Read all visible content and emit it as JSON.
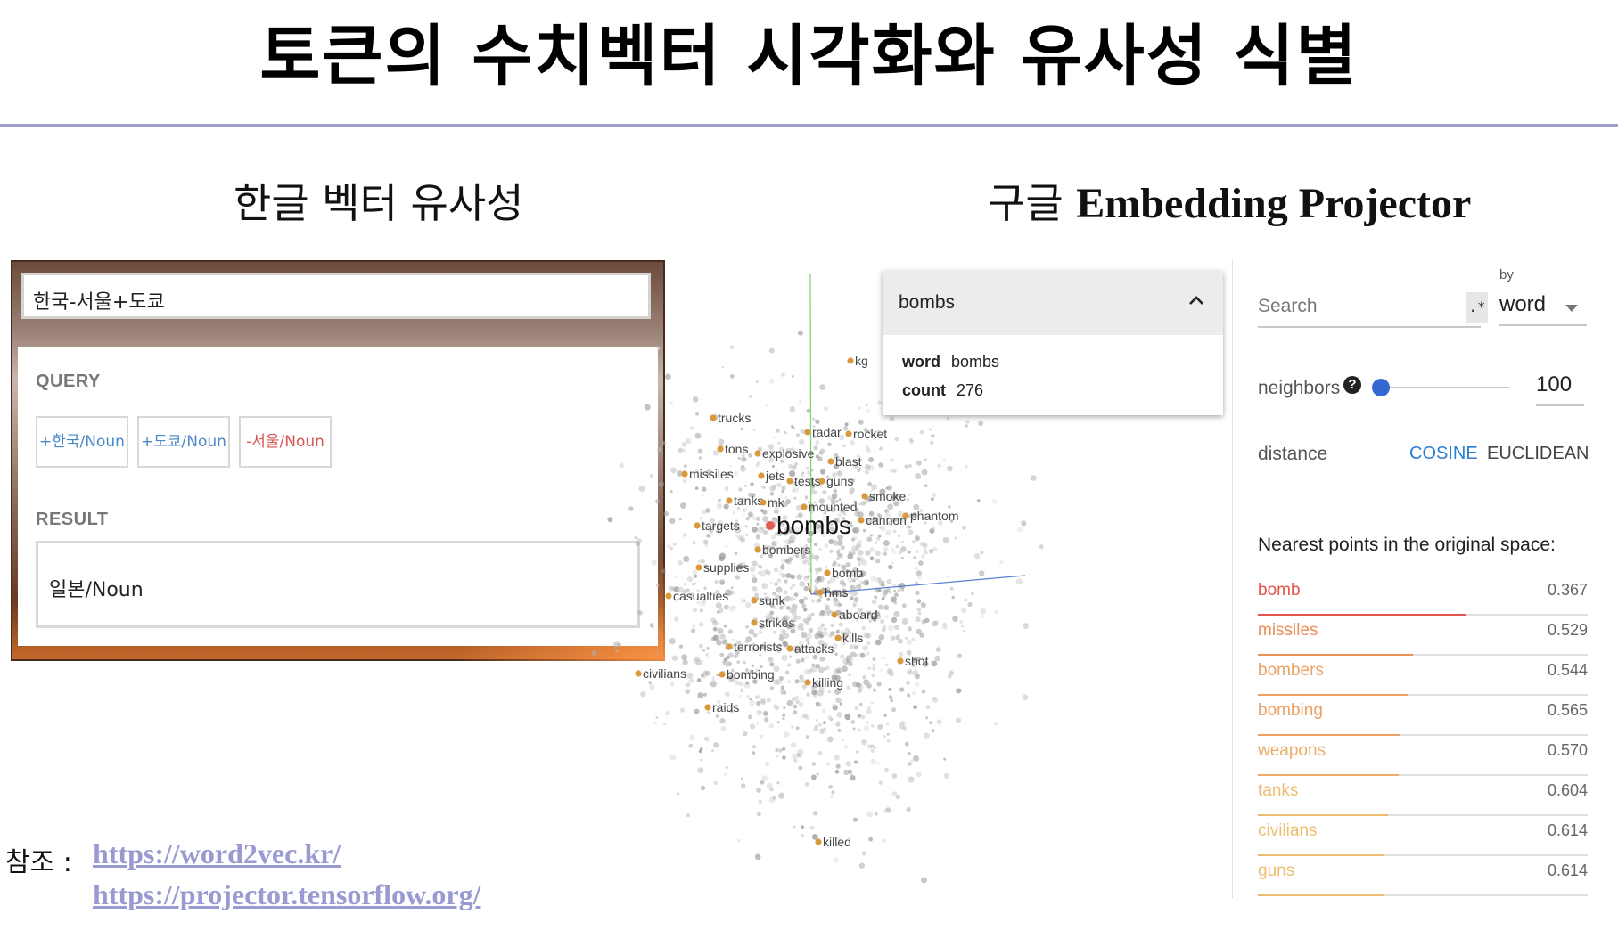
{
  "slide": {
    "title": "토큰의 수치벡터 시각화와 유사성 식별",
    "left_subtitle": "한글 벡터 유사성",
    "right_subtitle_kr": "구글",
    "right_subtitle_en": "Embedding Projector"
  },
  "word2vec": {
    "search_value": "한국-서울+도쿄",
    "query_label": "QUERY",
    "chips": [
      {
        "label": "+한국/Noun",
        "sign": "positive"
      },
      {
        "label": "+도쿄/Noun",
        "sign": "positive"
      },
      {
        "label": "-서울/Noun",
        "sign": "negative"
      }
    ],
    "result_label": "RESULT",
    "result_value": "일본/Noun"
  },
  "projector": {
    "tooltip": {
      "title": "bombs",
      "fields": [
        {
          "key": "word",
          "value": "bombs"
        },
        {
          "key": "count",
          "value": "276"
        }
      ]
    },
    "point_labels": [
      "kg",
      "trucks",
      "radar",
      "rocket",
      "tons",
      "explosive",
      "blast",
      "missiles",
      "jets",
      "tests",
      "guns",
      "tanks",
      "mk",
      "mounted",
      "smoke",
      "targets",
      "bombs",
      "cannon",
      "phantom",
      "bombers",
      "supplies",
      "bomb",
      "hms",
      "casualties",
      "sunk",
      "aboard",
      "strikes",
      "kills",
      "terrorists",
      "attacks",
      "shot",
      "civilians",
      "bombing",
      "killing",
      "raids",
      "killed"
    ],
    "search_placeholder": "Search",
    "regex_symbol": ".*",
    "by_label": "by",
    "by_value": "word",
    "neighbors_label": "neighbors",
    "neighbors_value": "100",
    "neighbors_fraction": 0.08,
    "distance_label": "distance",
    "distance_options": [
      "COSINE",
      "EUCLIDEAN"
    ],
    "distance_selected": "COSINE",
    "nearest_title": "Nearest points in the original space:",
    "nearest": [
      {
        "word": "bomb",
        "value": "0.367",
        "color": "#e5534b"
      },
      {
        "word": "missiles",
        "value": "0.529",
        "color": "#e9905a"
      },
      {
        "word": "bombers",
        "value": "0.544",
        "color": "#eaa266"
      },
      {
        "word": "bombing",
        "value": "0.565",
        "color": "#eaa266"
      },
      {
        "word": "weapons",
        "value": "0.570",
        "color": "#ebad6a"
      },
      {
        "word": "tanks",
        "value": "0.604",
        "color": "#edbe72"
      },
      {
        "word": "civilians",
        "value": "0.614",
        "color": "#edbe72"
      },
      {
        "word": "guns",
        "value": "0.614",
        "color": "#edbe72"
      }
    ]
  },
  "references": {
    "label": "참조 :",
    "links": [
      "https://word2vec.kr/",
      "https://projector.tensorflow.org/"
    ]
  }
}
